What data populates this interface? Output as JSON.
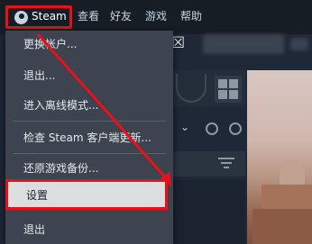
{
  "menubar": {
    "steam_label": "Steam",
    "view_label": "查看",
    "friends_label": "好友",
    "games_label": "游戏",
    "help_label": "帮助"
  },
  "menu": {
    "items": [
      {
        "label": "更换帐户..."
      },
      {
        "label": "退出..."
      },
      {
        "label": "进入离线模式..."
      },
      {
        "label": "检查 Steam 客户端更新..."
      },
      {
        "label": "还原游戏备份..."
      },
      {
        "label": "设置"
      },
      {
        "label": "退出"
      }
    ]
  },
  "header": {
    "close_glyph": "☒"
  },
  "annotation": {
    "highlight_color": "#e8101a"
  },
  "icons": [
    "steam-logo-icon",
    "grid-view-icon",
    "chevron-down-icon",
    "clock-icon",
    "play-icon",
    "filter-icon"
  ]
}
